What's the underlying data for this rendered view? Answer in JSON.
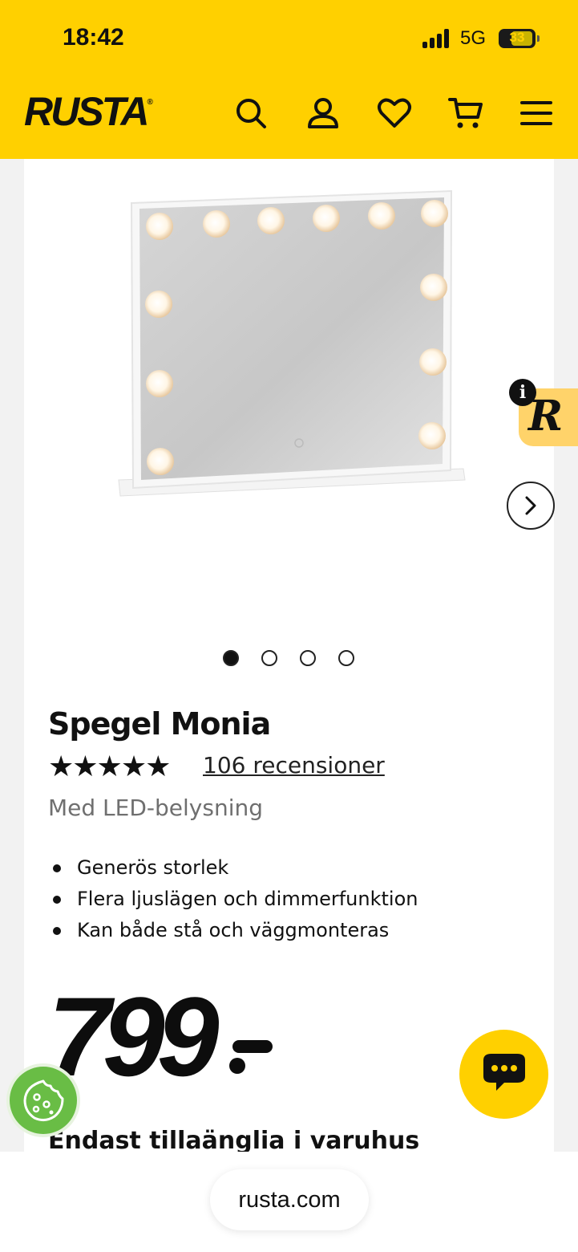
{
  "status_bar": {
    "time": "18:42",
    "network": "5G",
    "battery": "33"
  },
  "header": {
    "logo": "RUSTA",
    "logo_mark": "®"
  },
  "product": {
    "title": "Spegel Monia",
    "stars": "★★★★★",
    "rating": 5,
    "reviews": "106 recensioner",
    "subtitle": "Med LED-belysning",
    "features": [
      "Generös storlek",
      "Flera ljuslägen och dimmerfunktion",
      "Kan både stå och väggmonteras"
    ],
    "price": "799",
    "availability": "Endast tillaänglia i varuhus"
  },
  "gallery": {
    "image_count": 4,
    "active_index": 0
  },
  "widgets": {
    "r_badge": "R",
    "info": "i"
  },
  "browser": {
    "url": "rusta.com"
  },
  "colors": {
    "brand_yellow": "#ffd000",
    "cookie_green": "#69bd45",
    "text": "#111111",
    "muted": "#6f6f6f"
  }
}
